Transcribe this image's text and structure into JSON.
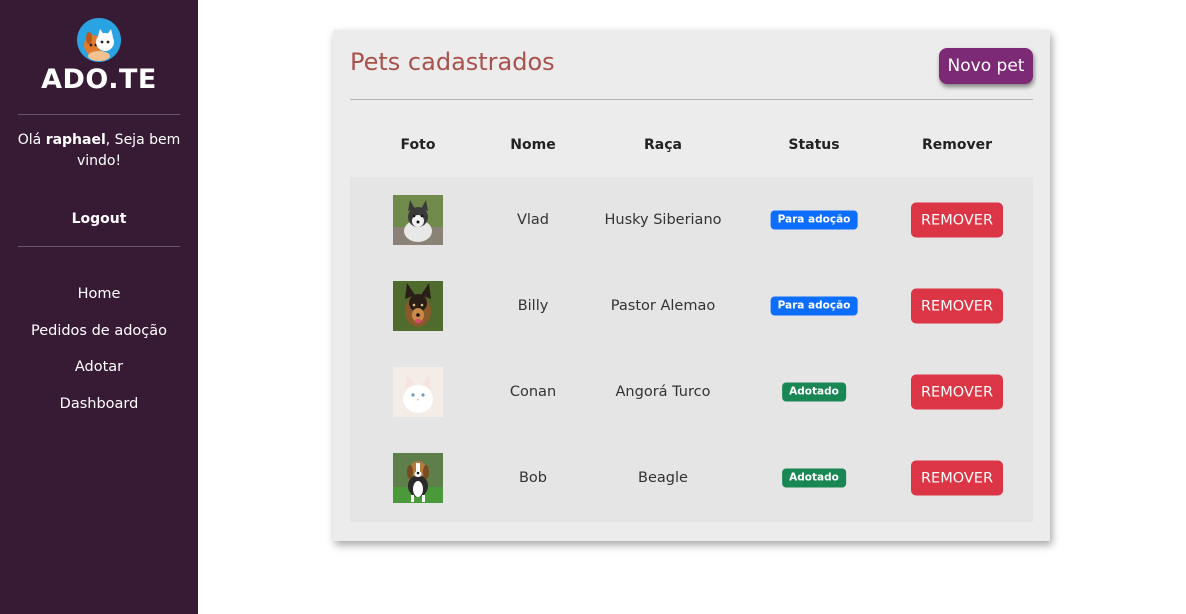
{
  "sidebar": {
    "brand": "ADO.TE",
    "logo_icon": "pets-logo-icon",
    "greeting_prefix": "Olá ",
    "username": "raphael",
    "greeting_suffix": ", Seja bem vindo!",
    "logout_label": "Logout",
    "nav": [
      {
        "label": "Home"
      },
      {
        "label": "Pedidos de adoção"
      },
      {
        "label": "Adotar"
      },
      {
        "label": "Dashboard"
      }
    ]
  },
  "main": {
    "title": "Pets cadastrados",
    "new_pet_label": "Novo pet",
    "columns": [
      "Foto",
      "Nome",
      "Raça",
      "Status",
      "Remover"
    ],
    "rows": [
      {
        "photo_icon": "husky-photo",
        "name": "Vlad",
        "breed": "Husky Siberiano",
        "status": "Para adoção",
        "status_color": "#0d6efd",
        "remove_label": "REMOVER"
      },
      {
        "photo_icon": "german-shepherd-photo",
        "name": "Billy",
        "breed": "Pastor Alemao",
        "status": "Para adoção",
        "status_color": "#0d6efd",
        "remove_label": "REMOVER"
      },
      {
        "photo_icon": "white-cat-photo",
        "name": "Conan",
        "breed": "Angorá Turco",
        "status": "Adotado",
        "status_color": "#198754",
        "remove_label": "REMOVER"
      },
      {
        "photo_icon": "beagle-photo",
        "name": "Bob",
        "breed": "Beagle",
        "status": "Adotado",
        "status_color": "#198754",
        "remove_label": "REMOVER"
      }
    ]
  },
  "colors": {
    "sidebar_bg": "#371b34",
    "title": "#a8524b",
    "new_pet_button": "#7c2a76",
    "remove_button": "#dc3545",
    "status_available": "#0d6efd",
    "status_adopted": "#198754"
  }
}
